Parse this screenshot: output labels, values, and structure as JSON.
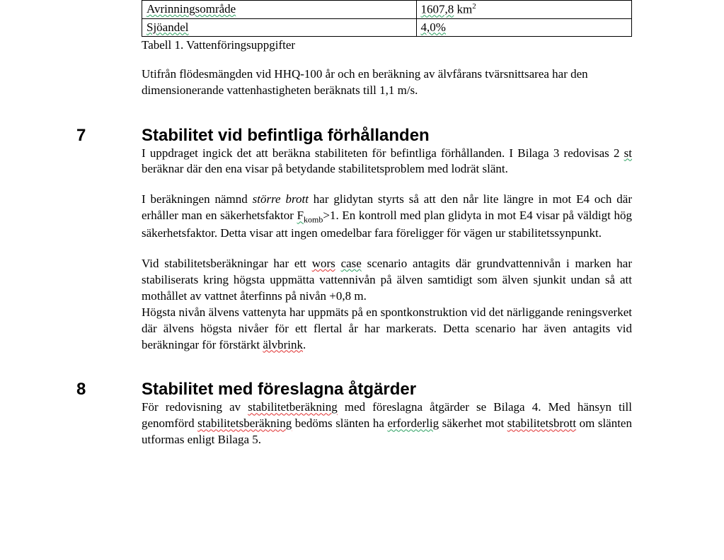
{
  "table": {
    "rows": [
      {
        "label": "Avrinningsområde",
        "value_prefix": "1607,8",
        "value_unit": " km",
        "value_sup": "2"
      },
      {
        "label": "Sjöandel",
        "value_prefix": "4,0%",
        "value_unit": "",
        "value_sup": ""
      }
    ],
    "caption": "Tabell 1. Vattenföringsuppgifter"
  },
  "intro_para": "Utifrån flödesmängden vid HHQ-100 år och en beräkning av älvfårans tvärsnittsarea har den dimensionerande vattenhastigheten beräknats till 1,1 m/s.",
  "section7": {
    "num": "7",
    "title": "Stabilitet vid befintliga förhållanden",
    "p1_a": "I uppdraget ingick det att beräkna stabiliteten för befintliga förhållanden. I Bilaga 3 redovisas 2 ",
    "p1_st": "st",
    "p1_b": " beräknar där den ena visar på betydande stabilitetsproblem med lodrät slänt.",
    "p2_a": "I beräkningen nämnd ",
    "p2_italic": "större brott",
    "p2_b": " har glidytan styrts så att den når lite längre in mot E4 och där erhåller man en säkerhetsfaktor ",
    "p2_f": "F",
    "p2_fsub": "komb",
    "p2_c": ">1. En kontroll med plan glidyta in mot E4 visar på väldigt hög säkerhetsfaktor. Detta visar att ingen omedelbar fara föreligger för vägen ur stabilitetssynpunkt.",
    "p3_a": "Vid stabilitetsberäkningar har ett ",
    "p3_wors": "wors",
    "p3_sp": " ",
    "p3_case": "case",
    "p3_b": " scenario antagits där grundvattennivån i marken har stabiliserats kring högsta uppmätta vattennivån på älven samtidigt som älven sjunkit undan så att mothållet av vattnet återfinns på nivån +0,8 m.",
    "p3b": "Högsta nivån älvens vattenyta har uppmäts på en spontkonstruktion vid det närliggande reningsverket där älvens högsta nivåer för ett flertal år har markerats. Detta scenario har även antagits vid beräkningar för förstärkt ",
    "p3b_alvbrink": "älvbrink",
    "p3b_end": "."
  },
  "section8": {
    "num": "8",
    "title": "Stabilitet med föreslagna åtgärder",
    "p1_a": "För redovisning av ",
    "p1_w1": "stabilitetberäkning",
    "p1_b": " med föreslagna åtgärder se Bilaga 4. Med hänsyn till genomförd ",
    "p1_w2": "stabilitetsberäkning",
    "p1_c": " bedöms slänten ha ",
    "p1_w3": "erforderlig",
    "p1_d": " säkerhet mot ",
    "p1_w4": "stabilitetsbrott",
    "p1_e": " om slänten utformas enligt Bilaga 5."
  }
}
